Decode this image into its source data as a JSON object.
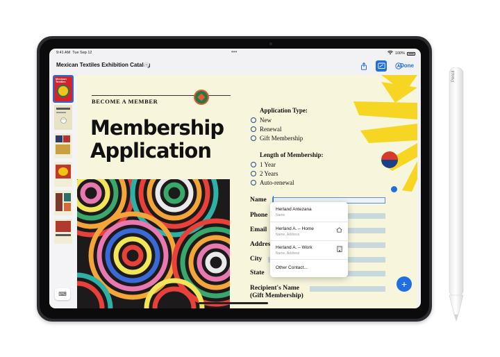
{
  "status": {
    "time": "9:41 AM",
    "date": "Tue Sep 12",
    "battery": "100%"
  },
  "toolbar": {
    "title": "Mexican Textiles Exhibition Catalog",
    "done_label": "Done",
    "icons": [
      "share-icon",
      "markup-icon",
      "autofill-icon"
    ]
  },
  "thumbnail_covers": [
    "Mexican Textiles"
  ],
  "form": {
    "become_member": "BECOME A MEMBER",
    "heading_line1": "Membership",
    "heading_line2": "Application",
    "application_type": {
      "title": "Application Type:",
      "options": [
        "New",
        "Renewal",
        "Gift Membership"
      ]
    },
    "length": {
      "title": "Length of Membership:",
      "options": [
        "1 Year",
        "2 Years",
        "Auto-renewal"
      ]
    },
    "fields": {
      "name": "Name",
      "phone": "Phone",
      "email": "Email",
      "address": "Address",
      "city": "City",
      "state": "State",
      "recipient1": "Recipient's Name",
      "recipient2": "(Gift Membership)"
    }
  },
  "suggestions": [
    {
      "main": "Herland Antezana",
      "sub": "Name",
      "icon": ""
    },
    {
      "main": "Herland A. – Home",
      "sub": "Name, Address",
      "icon": "house-icon"
    },
    {
      "main": "Herland A. – Work",
      "sub": "Name, Address",
      "icon": "building-icon"
    },
    {
      "main": "Other Contact...",
      "sub": "",
      "icon": ""
    }
  ],
  "pencil_label": "Pencil",
  "colors": {
    "accent": "#1f6fe0",
    "paper": "#f7f5dc",
    "sun": "#f6d623"
  }
}
